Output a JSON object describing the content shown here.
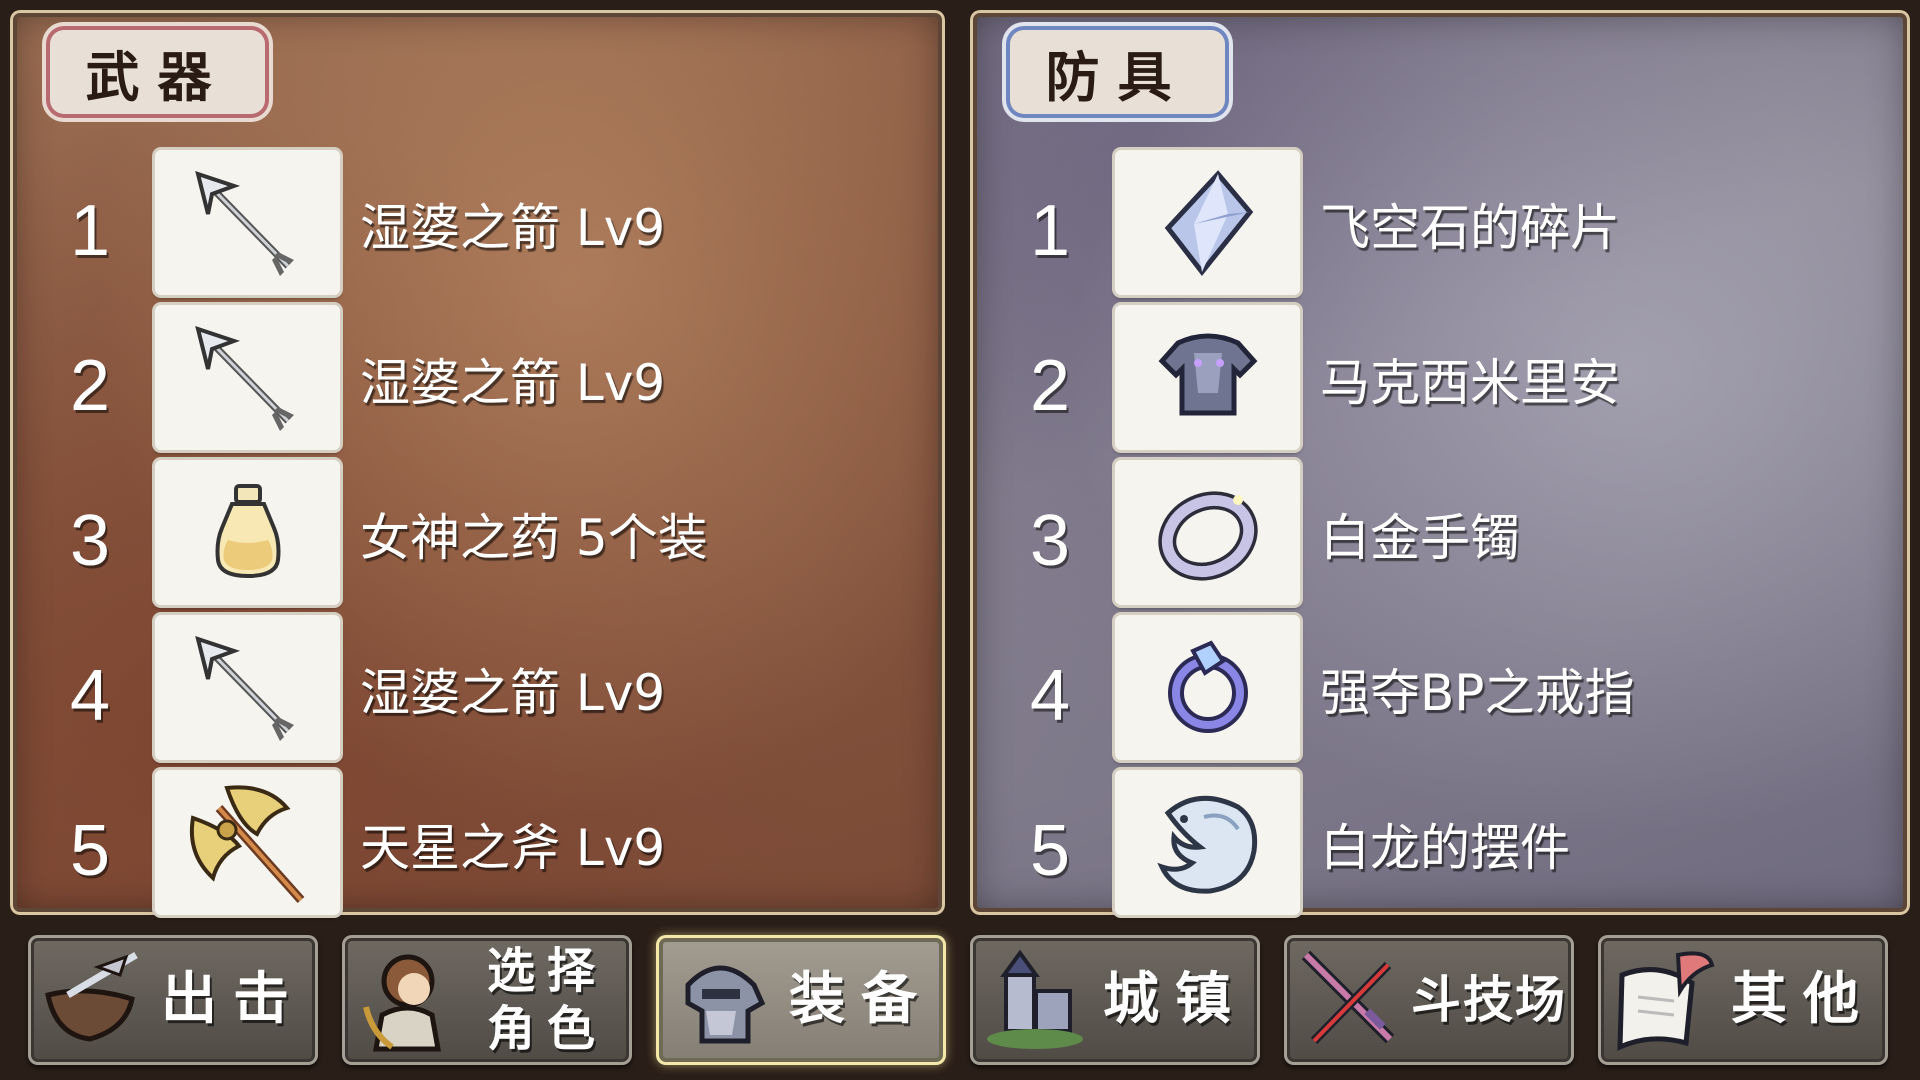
{
  "weapons": {
    "title": "武器",
    "items": [
      {
        "num": "1",
        "name": "湿婆之箭 Lv9",
        "icon": "arrow-icon"
      },
      {
        "num": "2",
        "name": "湿婆之箭 Lv9",
        "icon": "arrow-icon"
      },
      {
        "num": "3",
        "name": "女神之药 5个装",
        "icon": "potion-bottle-icon"
      },
      {
        "num": "4",
        "name": "湿婆之箭 Lv9",
        "icon": "arrow-icon"
      },
      {
        "num": "5",
        "name": "天星之斧 Lv9",
        "icon": "golden-axe-icon"
      }
    ]
  },
  "armor": {
    "title": "防具",
    "items": [
      {
        "num": "1",
        "name": "飞空石的碎片",
        "icon": "crystal-shard-icon"
      },
      {
        "num": "2",
        "name": "马克西米里安",
        "icon": "armor-icon"
      },
      {
        "num": "3",
        "name": "白金手镯",
        "icon": "bracelet-icon"
      },
      {
        "num": "4",
        "name": "强夺BP之戒指",
        "icon": "ring-icon"
      },
      {
        "num": "5",
        "name": "白龙的摆件",
        "icon": "dragon-figurine-icon"
      }
    ]
  },
  "nav": {
    "sortie": "出击",
    "select_line1": "选择",
    "select_line2": "角色",
    "equip": "装备",
    "town": "城镇",
    "arena": "斗技场",
    "other": "其他"
  },
  "colors": {
    "weapons_panel": "#8b5b43",
    "armor_panel": "#827c8e",
    "active_button_border": "#f3e8a8"
  }
}
